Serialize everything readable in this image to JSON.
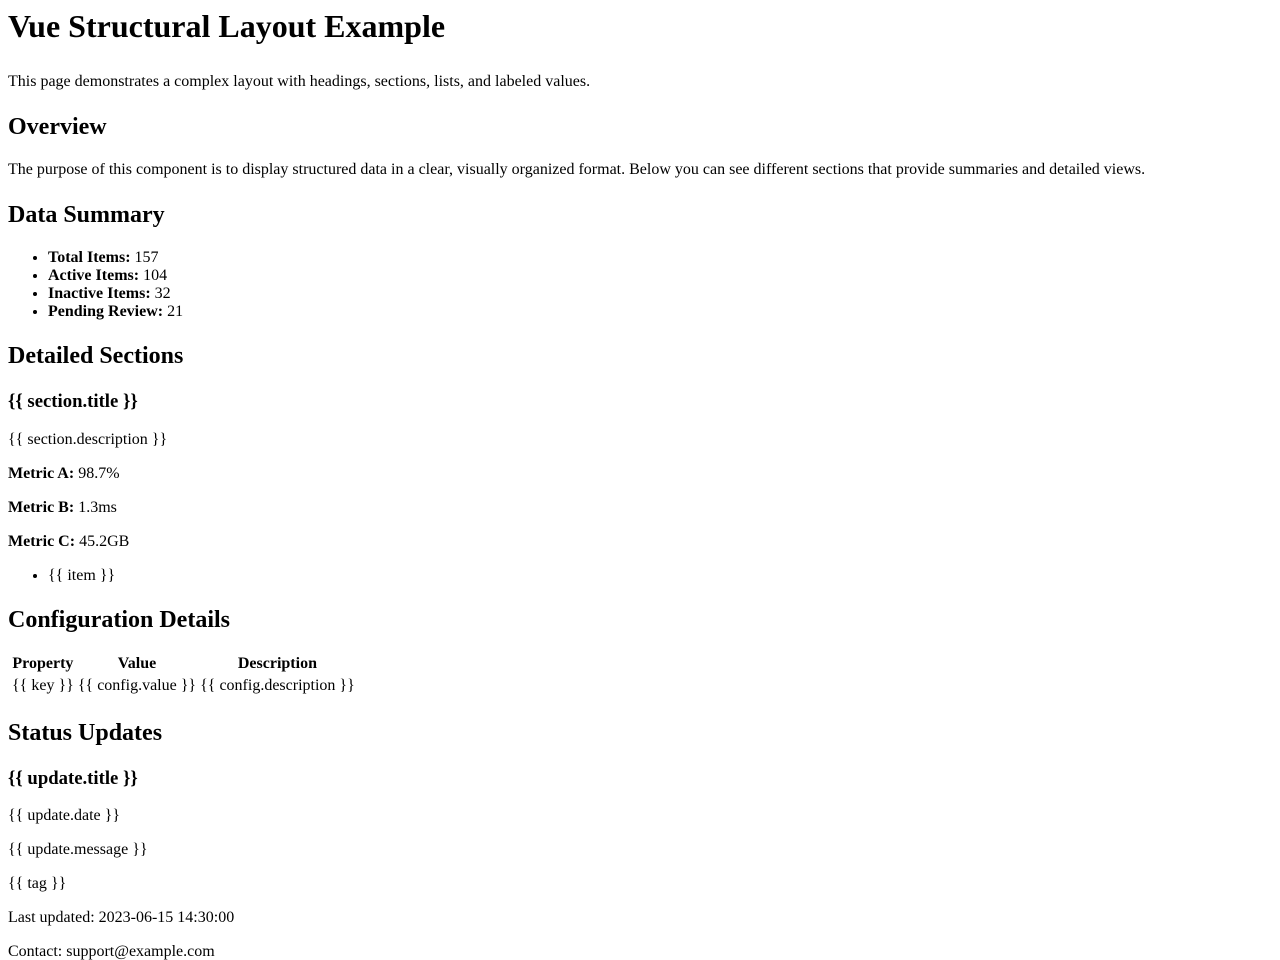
{
  "page": {
    "title": "Vue Structural Layout Example",
    "intro": "This page demonstrates a complex layout with headings, sections, lists, and labeled values."
  },
  "overview": {
    "heading": "Overview",
    "text": "The purpose of this component is to display structured data in a clear, visually organized format. Below you can see different sections that provide summaries and detailed views."
  },
  "summary": {
    "heading": "Data Summary",
    "items": [
      {
        "label": "Total Items:",
        "value": "157"
      },
      {
        "label": "Active Items:",
        "value": "104"
      },
      {
        "label": "Inactive Items:",
        "value": "32"
      },
      {
        "label": "Pending Review:",
        "value": "21"
      }
    ]
  },
  "detailed": {
    "heading": "Detailed Sections",
    "section_title": "{{ section.title }}",
    "section_description": "{{ section.description }}",
    "metrics": [
      {
        "label": "Metric A:",
        "value": "98.7%"
      },
      {
        "label": "Metric B:",
        "value": "1.3ms"
      },
      {
        "label": "Metric C:",
        "value": "45.2GB"
      }
    ],
    "items": [
      "{{ item }}"
    ]
  },
  "config": {
    "heading": "Configuration Details",
    "columns": [
      "Property",
      "Value",
      "Description"
    ],
    "rows": [
      [
        "{{ key }}",
        "{{ config.value }}",
        "{{ config.description }}"
      ]
    ]
  },
  "status": {
    "heading": "Status Updates",
    "update_title": "{{ update.title }}",
    "update_date": "{{ update.date }}",
    "update_message": "{{ update.message }}",
    "tag": "{{ tag }}"
  },
  "footer": {
    "last_updated_label": "Last updated:",
    "last_updated_value": "2023-06-15 14:30:00",
    "contact_label": "Contact:",
    "contact_value": "support@example.com"
  }
}
